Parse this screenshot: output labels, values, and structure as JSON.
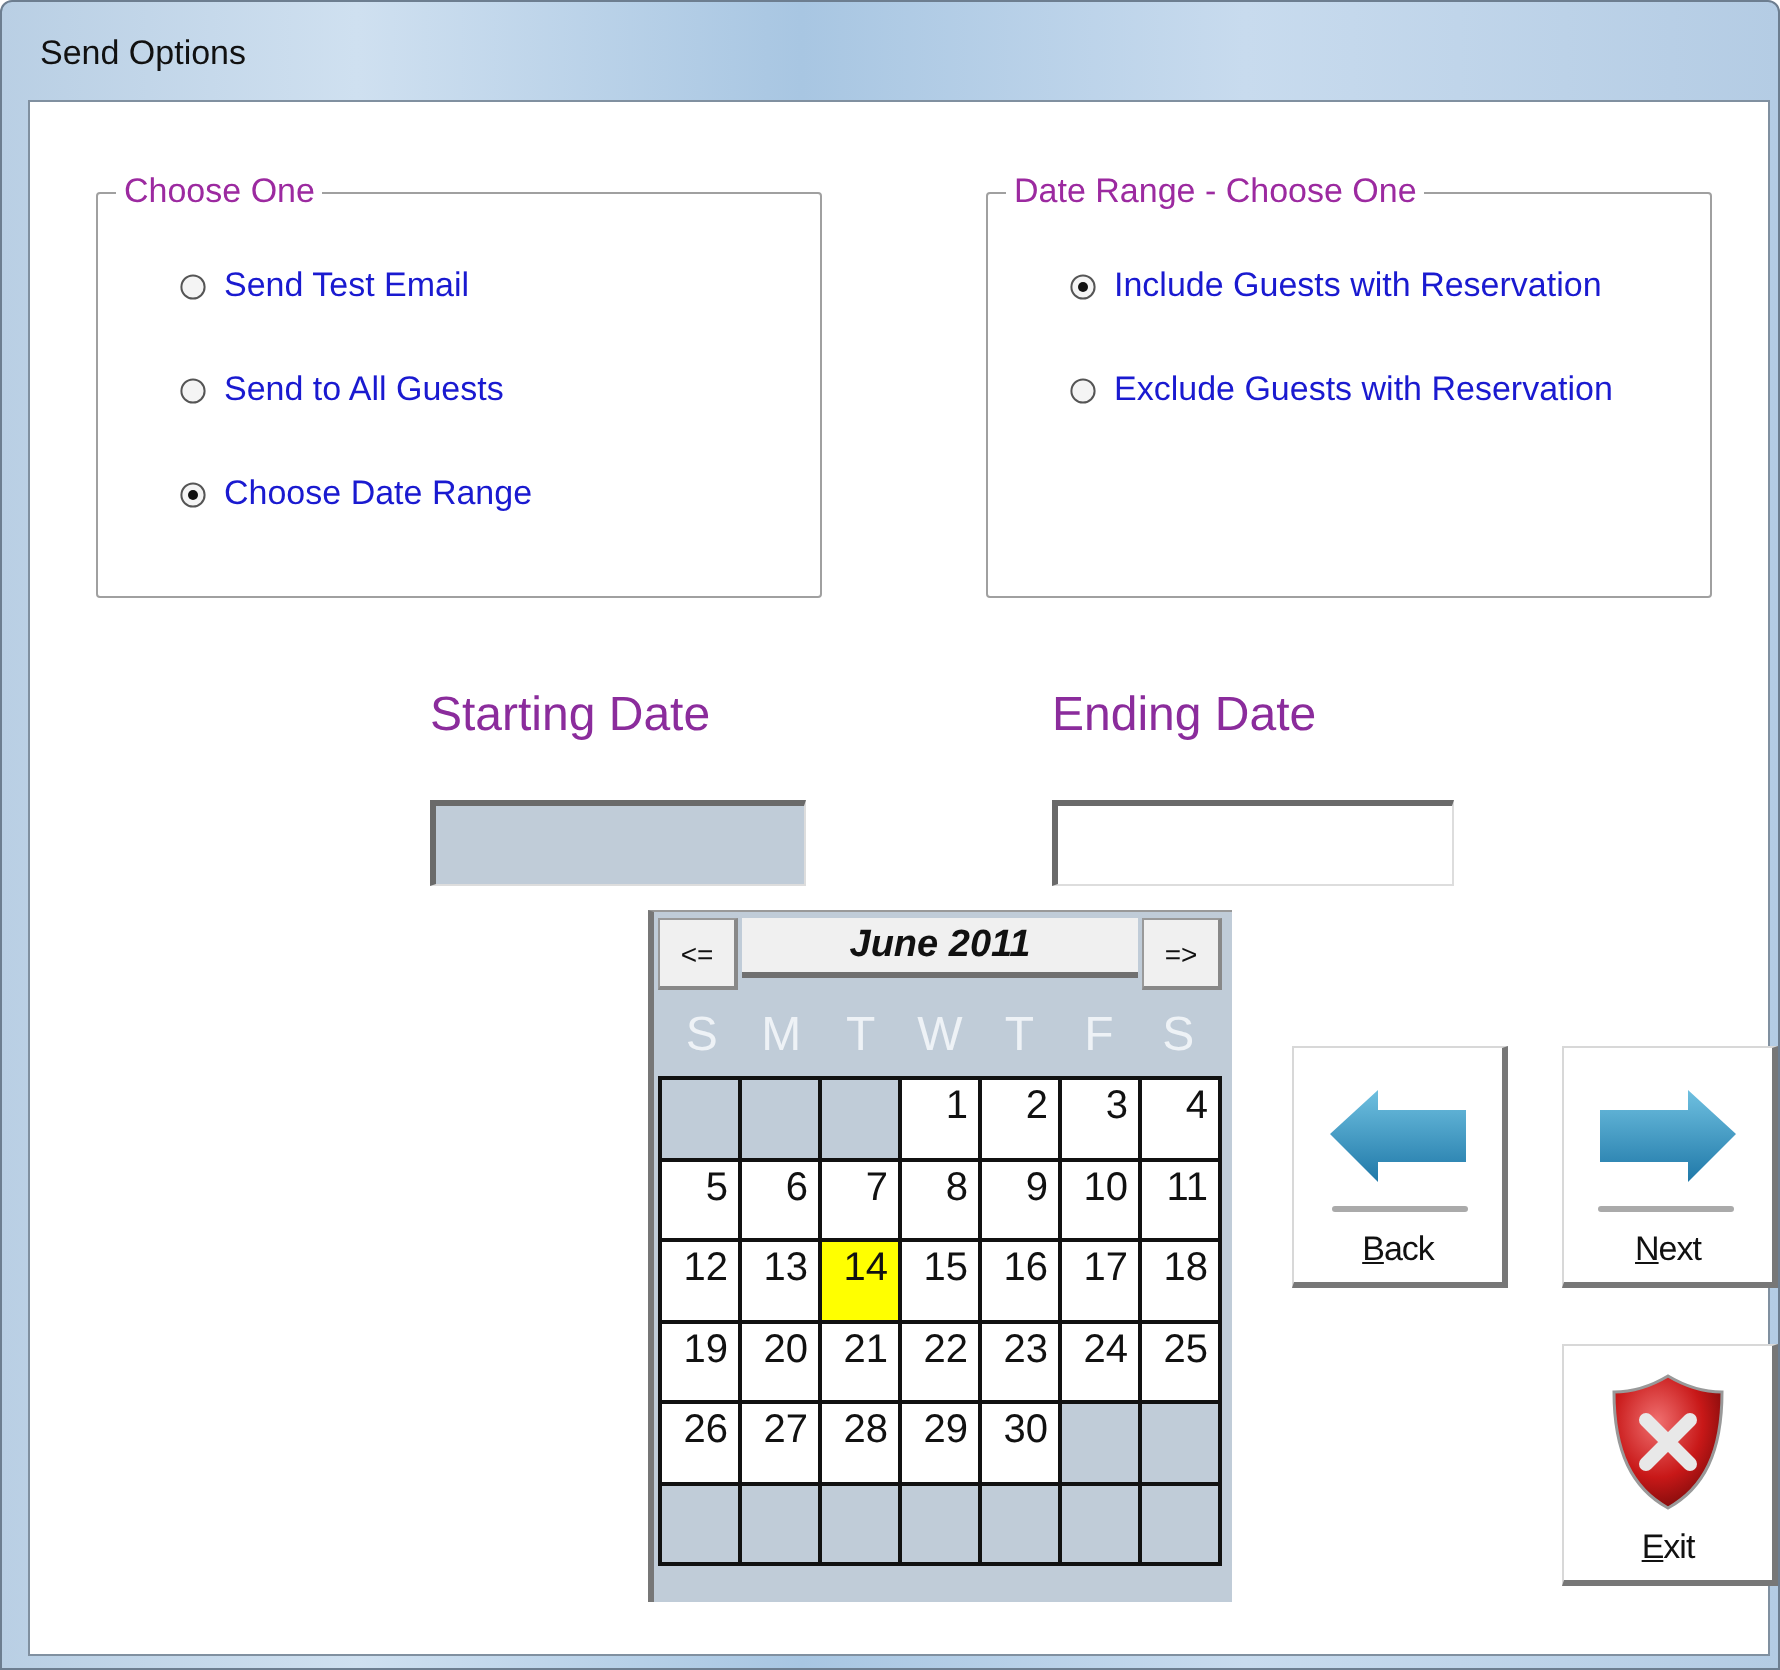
{
  "window": {
    "title": "Send Options"
  },
  "groups": [
    {
      "title": "Choose One",
      "options": [
        {
          "label": "Send Test Email",
          "selected": false
        },
        {
          "label": "Send to All Guests",
          "selected": false
        },
        {
          "label": "Choose Date Range",
          "selected": true
        }
      ]
    },
    {
      "title": "Date Range - Choose One",
      "options": [
        {
          "label": "Include Guests with Reservation",
          "selected": true
        },
        {
          "label": "Exclude Guests with Reservation",
          "selected": false
        }
      ]
    }
  ],
  "date_fields": [
    {
      "label": "Starting Date",
      "focused": true
    },
    {
      "label": "Ending Date",
      "focused": false
    }
  ],
  "calendar": {
    "prev": "<=",
    "title": "June 2011",
    "next": "=>",
    "weekdays": [
      "S",
      "M",
      "T",
      "W",
      "T",
      "F",
      "S"
    ],
    "cells": [
      {
        "kind": "blank"
      },
      {
        "kind": "blank"
      },
      {
        "kind": "blank"
      },
      {
        "kind": "day",
        "text": "1",
        "selected": false
      },
      {
        "kind": "day",
        "text": "2",
        "selected": false
      },
      {
        "kind": "day",
        "text": "3",
        "selected": false
      },
      {
        "kind": "day",
        "text": "4",
        "selected": false
      },
      {
        "kind": "day",
        "text": "5",
        "selected": false
      },
      {
        "kind": "day",
        "text": "6",
        "selected": false
      },
      {
        "kind": "day",
        "text": "7",
        "selected": false
      },
      {
        "kind": "day",
        "text": "8",
        "selected": false
      },
      {
        "kind": "day",
        "text": "9",
        "selected": false
      },
      {
        "kind": "day",
        "text": "10",
        "selected": false
      },
      {
        "kind": "day",
        "text": "11",
        "selected": false
      },
      {
        "kind": "day",
        "text": "12",
        "selected": false
      },
      {
        "kind": "day",
        "text": "13",
        "selected": false
      },
      {
        "kind": "day",
        "text": "14",
        "selected": true
      },
      {
        "kind": "day",
        "text": "15",
        "selected": false
      },
      {
        "kind": "day",
        "text": "16",
        "selected": false
      },
      {
        "kind": "day",
        "text": "17",
        "selected": false
      },
      {
        "kind": "day",
        "text": "18",
        "selected": false
      },
      {
        "kind": "day",
        "text": "19",
        "selected": false
      },
      {
        "kind": "day",
        "text": "20",
        "selected": false
      },
      {
        "kind": "day",
        "text": "21",
        "selected": false
      },
      {
        "kind": "day",
        "text": "22",
        "selected": false
      },
      {
        "kind": "day",
        "text": "23",
        "selected": false
      },
      {
        "kind": "day",
        "text": "24",
        "selected": false
      },
      {
        "kind": "day",
        "text": "25",
        "selected": false
      },
      {
        "kind": "day",
        "text": "26",
        "selected": false
      },
      {
        "kind": "day",
        "text": "27",
        "selected": false
      },
      {
        "kind": "day",
        "text": "28",
        "selected": false
      },
      {
        "kind": "day",
        "text": "29",
        "selected": false
      },
      {
        "kind": "day",
        "text": "30",
        "selected": false
      },
      {
        "kind": "blank"
      },
      {
        "kind": "blank"
      },
      {
        "kind": "blank"
      },
      {
        "kind": "blank"
      },
      {
        "kind": "blank"
      },
      {
        "kind": "blank"
      },
      {
        "kind": "blank"
      },
      {
        "kind": "blank"
      },
      {
        "kind": "blank"
      }
    ]
  },
  "buttons": [
    {
      "label": "Back",
      "kind": "back"
    },
    {
      "label": "Next",
      "kind": "next"
    },
    {
      "label": "Exit",
      "kind": "exit"
    }
  ]
}
